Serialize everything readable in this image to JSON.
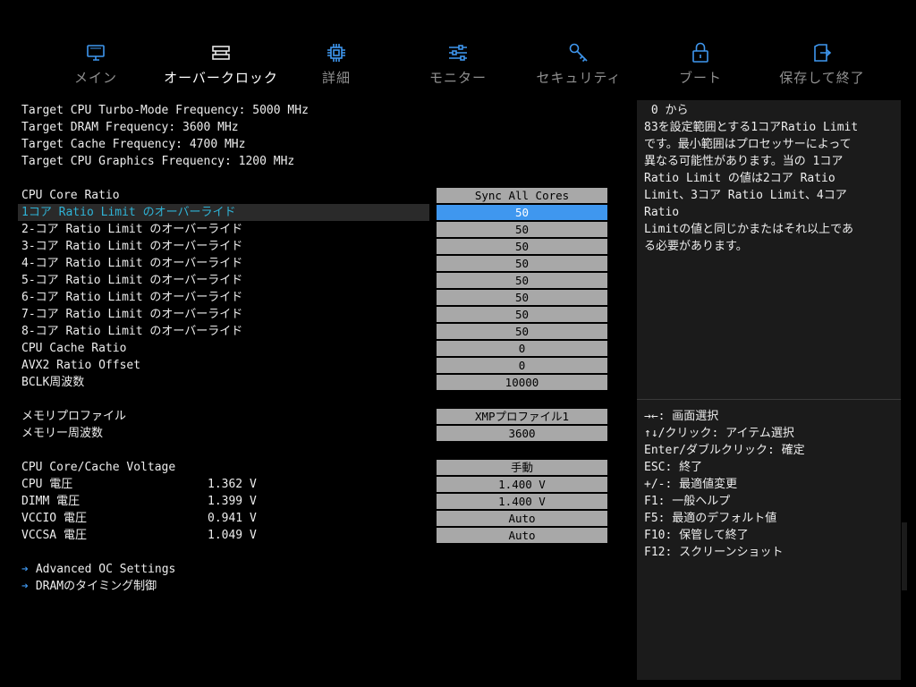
{
  "tabs": [
    {
      "label": "メイン",
      "icon": "main-icon"
    },
    {
      "label": "オーバークロック",
      "icon": "overclock-icon"
    },
    {
      "label": "詳細",
      "icon": "cpu-chip-icon"
    },
    {
      "label": "モニター",
      "icon": "sliders-icon"
    },
    {
      "label": "セキュリティ",
      "icon": "key-icon"
    },
    {
      "label": "ブート",
      "icon": "lock-icon"
    },
    {
      "label": "保存して終了",
      "icon": "exit-door-icon"
    }
  ],
  "active_tab": "オーバークロック",
  "targets": [
    "Target CPU Turbo-Mode Frequency: 5000 MHz",
    "Target DRAM Frequency: 3600 MHz",
    "Target Cache Frequency: 4700 MHz",
    "Target CPU Graphics Frequency: 1200 MHz"
  ],
  "settings": {
    "cpu_core_ratio": {
      "label": "CPU Core Ratio",
      "value": "Sync All Cores"
    },
    "ratio_limits": [
      {
        "label": "1コア Ratio Limit のオーバーライド",
        "value": "50"
      },
      {
        "label": "2-コア Ratio Limit のオーバーライド",
        "value": "50"
      },
      {
        "label": "3-コア Ratio Limit のオーバーライド",
        "value": "50"
      },
      {
        "label": "4-コア Ratio Limit のオーバーライド",
        "value": "50"
      },
      {
        "label": "5-コア Ratio Limit のオーバーライド",
        "value": "50"
      },
      {
        "label": "6-コア Ratio Limit のオーバーライド",
        "value": "50"
      },
      {
        "label": "7-コア Ratio Limit のオーバーライド",
        "value": "50"
      },
      {
        "label": "8-コア Ratio Limit のオーバーライド",
        "value": "50"
      }
    ],
    "cpu_cache_ratio": {
      "label": "CPU Cache Ratio",
      "value": "0"
    },
    "avx2_ratio_offset": {
      "label": "AVX2 Ratio Offset",
      "value": "0"
    },
    "bclk": {
      "label": "BCLK周波数",
      "value": "10000"
    },
    "memory_profile": {
      "label": "メモリプロファイル",
      "value": "XMPプロファイル1"
    },
    "memory_frequency": {
      "label": "メモリー周波数",
      "value": "3600"
    },
    "voltage_mode": {
      "label": "CPU Core/Cache Voltage",
      "value": "手動"
    },
    "voltages": [
      {
        "label": "CPU 電圧",
        "current": "1.362 V",
        "value": "1.400 V"
      },
      {
        "label": "DIMM 電圧",
        "current": "1.399 V",
        "value": "1.400 V"
      },
      {
        "label": "VCCIO 電圧",
        "current": "0.941 V",
        "value": "Auto"
      },
      {
        "label": "VCCSA 電圧",
        "current": "1.049 V",
        "value": "Auto"
      }
    ]
  },
  "links": [
    "Advanced OC Settings",
    "DRAMのタイミング制御"
  ],
  "help": {
    "description": " 0 から\n83を設定範囲とする1コアRatio Limit\nです。最小範囲はプロセッサーによって\n異なる可能性があります。当の 1コア\nRatio Limit の値は2コア Ratio\nLimit、3コア Ratio Limit、4コア\nRatio\nLimitの値と同じかまたはそれ以上であ\nる必要があります。",
    "keys": [
      "→←: 画面選択",
      "↑↓/クリック: アイテム選択",
      "Enter/ダブルクリック: 確定",
      "ESC: 終了",
      "+/-: 最適値変更",
      "F1: 一般ヘルプ",
      "F5: 最適のデフォルト値",
      "F10: 保管して終了",
      "F12: スクリーンショット"
    ]
  },
  "colors": {
    "accent": "#3f97ef",
    "selected_label": "#2fb3d6",
    "field_bg": "#a8a8a8",
    "panel_bg": "#1b1b1b"
  }
}
